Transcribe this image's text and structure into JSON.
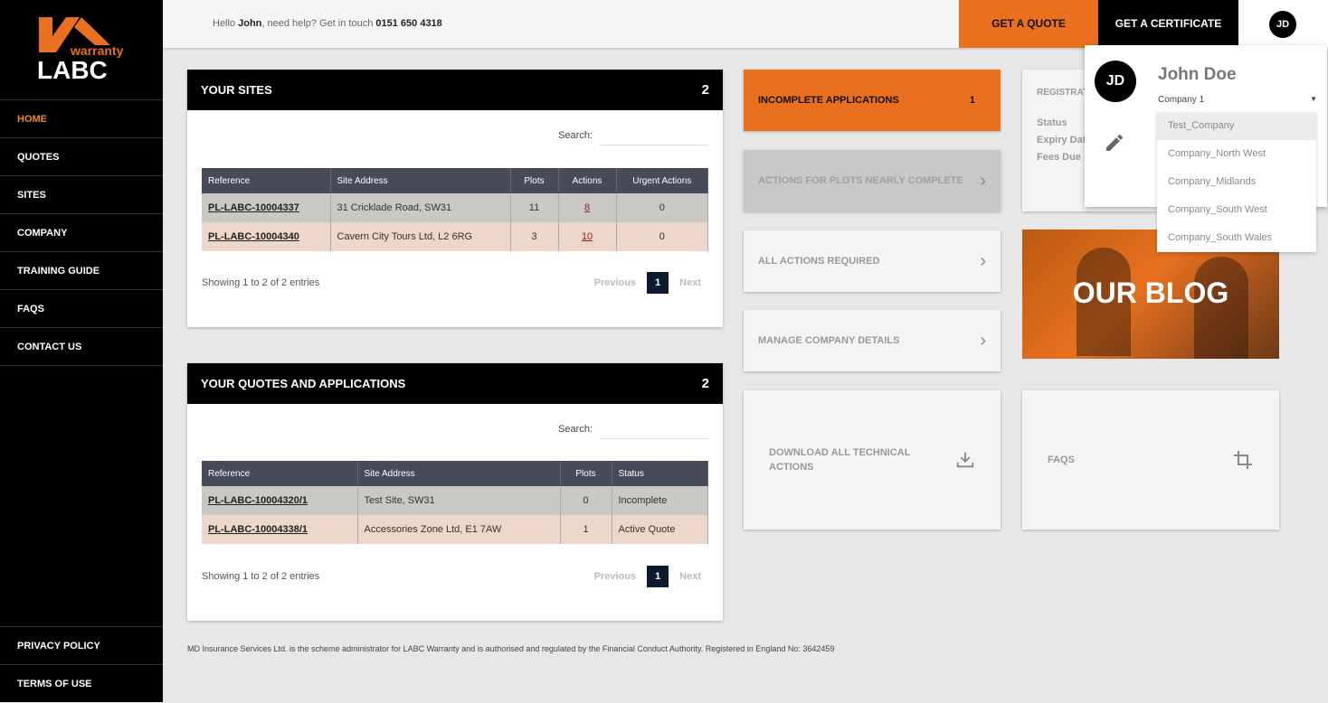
{
  "logo": {
    "text_top": "warranty",
    "text_main": "LABC"
  },
  "nav": [
    {
      "label": "HOME",
      "active": true
    },
    {
      "label": "QUOTES"
    },
    {
      "label": "SITES"
    },
    {
      "label": "COMPANY"
    },
    {
      "label": "TRAINING GUIDE"
    },
    {
      "label": "FAQS"
    },
    {
      "label": "CONTACT US"
    }
  ],
  "bottom_nav": [
    {
      "label": "PRIVACY POLICY"
    },
    {
      "label": "TERMS OF USE"
    }
  ],
  "header": {
    "hello": "Hello ",
    "name": "John",
    "help": ", need help? Get in touch ",
    "phone": "0151 650 4318",
    "quote_btn": "GET A QUOTE",
    "cert_btn": "GET A CERTIFICATE",
    "avatar": "JD"
  },
  "colors": {
    "accent": "#e8701f",
    "dark": "#000000",
    "table_header": "#474a58"
  },
  "sites": {
    "title": "YOUR SITES",
    "count": "2",
    "search_label": "Search:",
    "columns": [
      "Reference",
      "Site Address",
      "Plots",
      "Actions",
      "Urgent Actions"
    ],
    "rows": [
      [
        "PL-LABC-10004337",
        "31 Cricklade Road, SW31",
        "11",
        "8",
        "0"
      ],
      [
        "PL-LABC-10004340",
        "Cavern City Tours Ltd, L2 6RG",
        "3",
        "10",
        "0"
      ]
    ],
    "showing": "Showing 1 to 2 of 2 entries",
    "prev": "Previous",
    "page": "1",
    "next": "Next"
  },
  "quotes": {
    "title": "YOUR QUOTES AND APPLICATIONS",
    "count": "2",
    "search_label": "Search:",
    "columns": [
      "Reference",
      "Site Address",
      "Plots",
      "Status"
    ],
    "rows": [
      [
        "PL-LABC-10004320/1",
        "Test Site, SW31",
        "0",
        "Incomplete"
      ],
      [
        "PL-LABC-10004338/1",
        "Accessories Zone Ltd, E1 7AW",
        "1",
        "Active Quote"
      ]
    ],
    "showing": "Showing 1 to 2 of 2 entries",
    "prev": "Previous",
    "page": "1",
    "next": "Next"
  },
  "tiles": {
    "incomplete": "INCOMPLETE APPLICATIONS",
    "incomplete_count": "1",
    "plots": "ACTIONS FOR PLOTS NEARLY COMPLETE",
    "all_actions": "ALL ACTIONS REQUIRED",
    "manage": "MANAGE COMPANY DETAILS",
    "download": "DOWNLOAD ALL TECHNICAL ACTIONS",
    "faqs": "FAQS",
    "blog": "OUR BLOG"
  },
  "registration": {
    "title": "REGISTRAT",
    "status": "Status",
    "expiry": "Expiry Date",
    "fees": "Fees Due"
  },
  "profile": {
    "avatar": "JD",
    "name": "John Doe",
    "company": "Company 1",
    "options": [
      "Test_Company",
      "Company_North West",
      "Company_Midlands",
      "Company_South West",
      "Company_South Wales"
    ]
  },
  "footer": "MD Insurance Services Ltd. is the scheme administrator for LABC Warranty and is authorised and regulated by the Financial Conduct Authority. Registered in England No: 3642459"
}
